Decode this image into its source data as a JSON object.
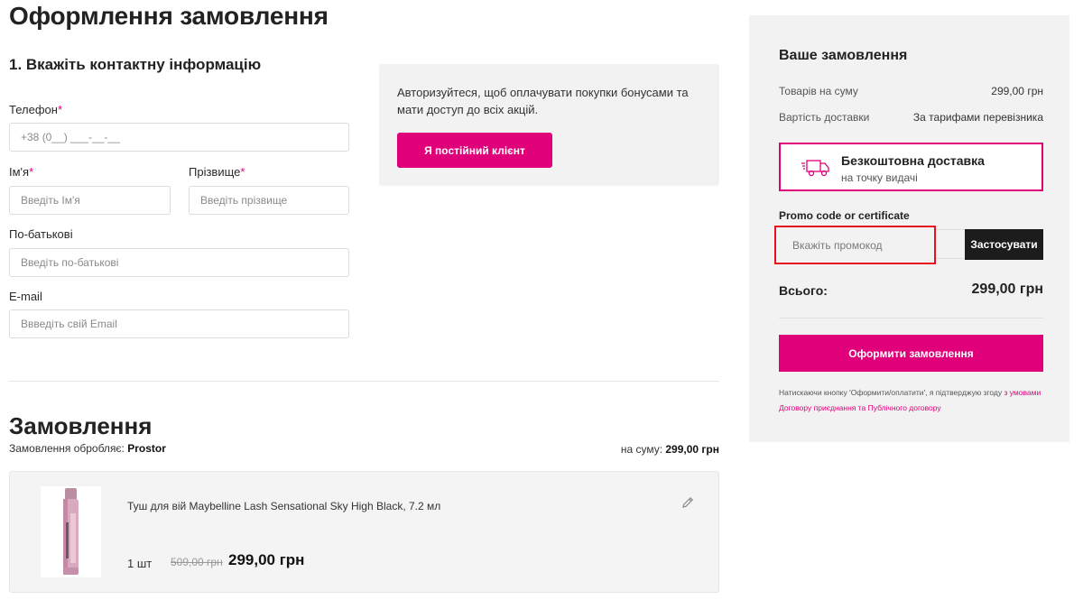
{
  "page_title": "Оформлення замовлення",
  "contact": {
    "section_title": "1. Вкажіть контактну інформацію",
    "phone_label": "Телефон",
    "phone_placeholder": "+38 (0__) ___-__-__",
    "first_name_label": "Ім'я",
    "first_name_placeholder": "Введіть Ім'я",
    "last_name_label": "Прізвище",
    "last_name_placeholder": "Введіть прізвище",
    "patronymic_label": "По-батькові",
    "patronymic_placeholder": "Введіть по-батькові",
    "email_label": "E-mail",
    "email_placeholder": "Ввведіть свій Email",
    "required_mark": "*"
  },
  "auth": {
    "text": "Авторизуйтеся, щоб оплачувати покупки бонусами та мати доступ до всіх акцій.",
    "button_label": "Я постійний клієнт"
  },
  "order": {
    "title": "Замовлення",
    "processed_by_label": "Замовлення обробляє:",
    "processed_by_value": "Prostor",
    "sum_label": "на суму:",
    "sum_value": "299,00 грн",
    "product": {
      "name": "Туш для вій Maybelline Lash Sensational Sky High Black, 7.2 мл",
      "qty": "1 шт",
      "old_price": "509,00 грн",
      "new_price": "299,00 грн",
      "edit_icon": "pencil-icon"
    }
  },
  "summary": {
    "title": "Ваше замовлення",
    "goods_label": "Товарів на суму",
    "goods_value": "299,00 грн",
    "delivery_label": "Вартість доставки",
    "delivery_value": "За тарифами перевізника",
    "free_delivery_title": "Безкоштовна доставка",
    "free_delivery_sub": "на точку видачі",
    "free_delivery_icon": "truck-icon",
    "promo_label": "Promo code or certificate",
    "promo_placeholder": "Вкажіть промокод",
    "apply_label": "Застосувати",
    "total_label": "Всього:",
    "total_value": "299,00 грн",
    "checkout_label": "Оформити замовлення",
    "legal_text": "Натискаючи кнопку 'Оформити/оплатити', я підтверджую згоду",
    "legal_link": "з умовами Договору приєднання та Публічного договору"
  },
  "colors": {
    "accent": "#e0007a",
    "dark_button": "#1c1c1c",
    "panel_bg": "#f2f2f2",
    "highlight": "#e8101c"
  }
}
